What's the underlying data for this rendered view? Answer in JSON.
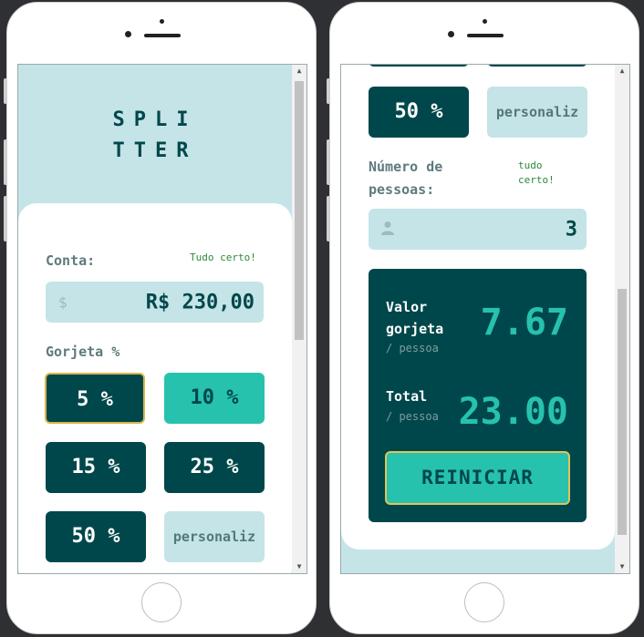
{
  "app": {
    "logo_line1": "SPLI",
    "logo_line2": "TTER"
  },
  "bill": {
    "label": "Conta:",
    "status": "Tudo certo!",
    "value": "R$ 230,00",
    "currency_icon": "$"
  },
  "tip": {
    "label": "Gorjeta %",
    "options": [
      "5 %",
      "10 %",
      "15 %",
      "25 %",
      "50 %"
    ],
    "custom_placeholder": "personaliz",
    "selected": "10 %"
  },
  "people": {
    "label_line1": "Número de",
    "label_line2": "pessoas:",
    "status_line1": "tudo",
    "status_line2": "certo!",
    "value": "3",
    "icon": "person-icon"
  },
  "results": {
    "tip_label_line1": "Valor",
    "tip_label_line2": "gorjeta",
    "per_person": "/ pessoa",
    "tip_value": "7.67",
    "total_label": "Total",
    "total_value": "23.00",
    "reset_label": "REINICIAR"
  },
  "colors": {
    "dark_teal": "#00474b",
    "accent": "#26c2ae",
    "light": "#c5e4e7"
  }
}
